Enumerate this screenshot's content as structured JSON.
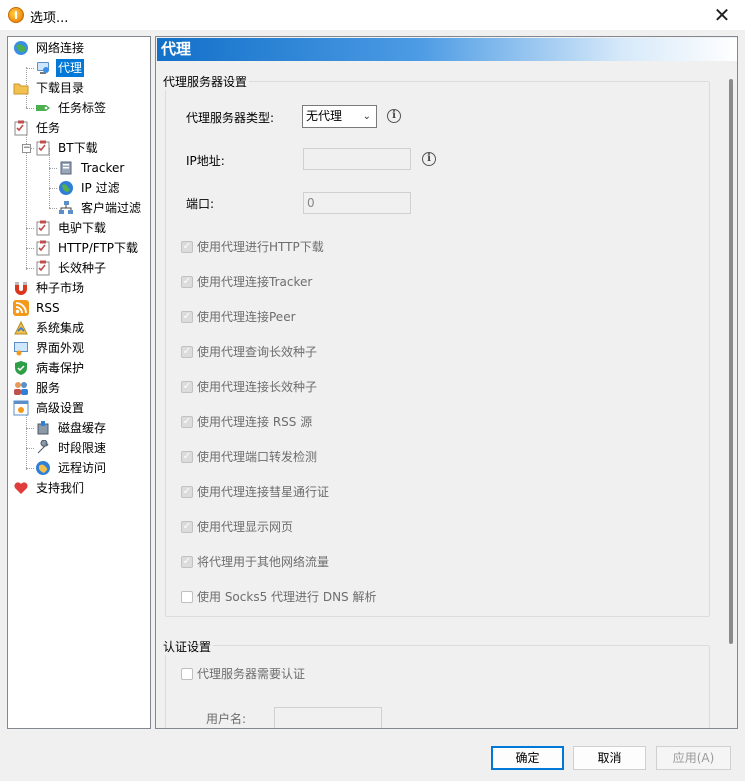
{
  "window": {
    "title": "选项...",
    "close_glyph": "✕"
  },
  "tree": {
    "items": [
      {
        "label": "网络连接",
        "icon": "globe-network-icon"
      },
      {
        "label": "代理",
        "icon": "proxy-computer-icon",
        "selected": true
      },
      {
        "label": "下载目录",
        "icon": "folder-icon"
      },
      {
        "label": "任务标签",
        "icon": "tag-icon"
      },
      {
        "label": "任务",
        "icon": "checklist-icon"
      },
      {
        "label": "BT下载",
        "icon": "checklist-icon"
      },
      {
        "label": "Tracker",
        "icon": "server-icon"
      },
      {
        "label": "IP 过滤",
        "icon": "globe-icon"
      },
      {
        "label": "客户端过滤",
        "icon": "network-clients-icon"
      },
      {
        "label": "电驴下载",
        "icon": "checklist-icon"
      },
      {
        "label": "HTTP/FTP下载",
        "icon": "checklist-icon"
      },
      {
        "label": "长效种子",
        "icon": "checklist-icon"
      },
      {
        "label": "种子市场",
        "icon": "magnet-icon"
      },
      {
        "label": "RSS",
        "icon": "rss-icon"
      },
      {
        "label": "系统集成",
        "icon": "integration-icon"
      },
      {
        "label": "界面外观",
        "icon": "appearance-icon"
      },
      {
        "label": "病毒保护",
        "icon": "shield-icon"
      },
      {
        "label": "服务",
        "icon": "users-icon"
      },
      {
        "label": "高级设置",
        "icon": "advanced-settings-icon"
      },
      {
        "label": "磁盘缓存",
        "icon": "disk-cache-icon"
      },
      {
        "label": "时段限速",
        "icon": "wrench-icon"
      },
      {
        "label": "远程访问",
        "icon": "remote-globe-icon"
      },
      {
        "label": "支持我们",
        "icon": "heart-icon"
      }
    ]
  },
  "panel": {
    "header": "代理",
    "proxy_group": {
      "title": "代理服务器设置",
      "type_label": "代理服务器类型:",
      "type_value": "无代理",
      "ip_label": "IP地址:",
      "ip_value": "",
      "port_label": "端口:",
      "port_value": "0",
      "info_glyph": "i",
      "checkboxes": [
        {
          "label": "使用代理进行HTTP下载",
          "checked": true
        },
        {
          "label": "使用代理连接Tracker",
          "checked": true
        },
        {
          "label": "使用代理连接Peer",
          "checked": true
        },
        {
          "label": "使用代理查询长效种子",
          "checked": true
        },
        {
          "label": "使用代理连接长效种子",
          "checked": true
        },
        {
          "label": "使用代理连接 RSS 源",
          "checked": true
        },
        {
          "label": "使用代理端口转发检测",
          "checked": true
        },
        {
          "label": "使用代理连接彗星通行证",
          "checked": true
        },
        {
          "label": "使用代理显示网页",
          "checked": true
        },
        {
          "label": "将代理用于其他网络流量",
          "checked": true
        },
        {
          "label": "使用 Socks5 代理进行 DNS 解析",
          "checked": false
        }
      ]
    },
    "auth_group": {
      "title": "认证设置",
      "require_auth_label": "代理服务器需要认证",
      "require_auth_checked": false,
      "username_label": "用户名:"
    }
  },
  "buttons": {
    "ok": "确定",
    "cancel": "取消",
    "apply": "应用(A)"
  }
}
